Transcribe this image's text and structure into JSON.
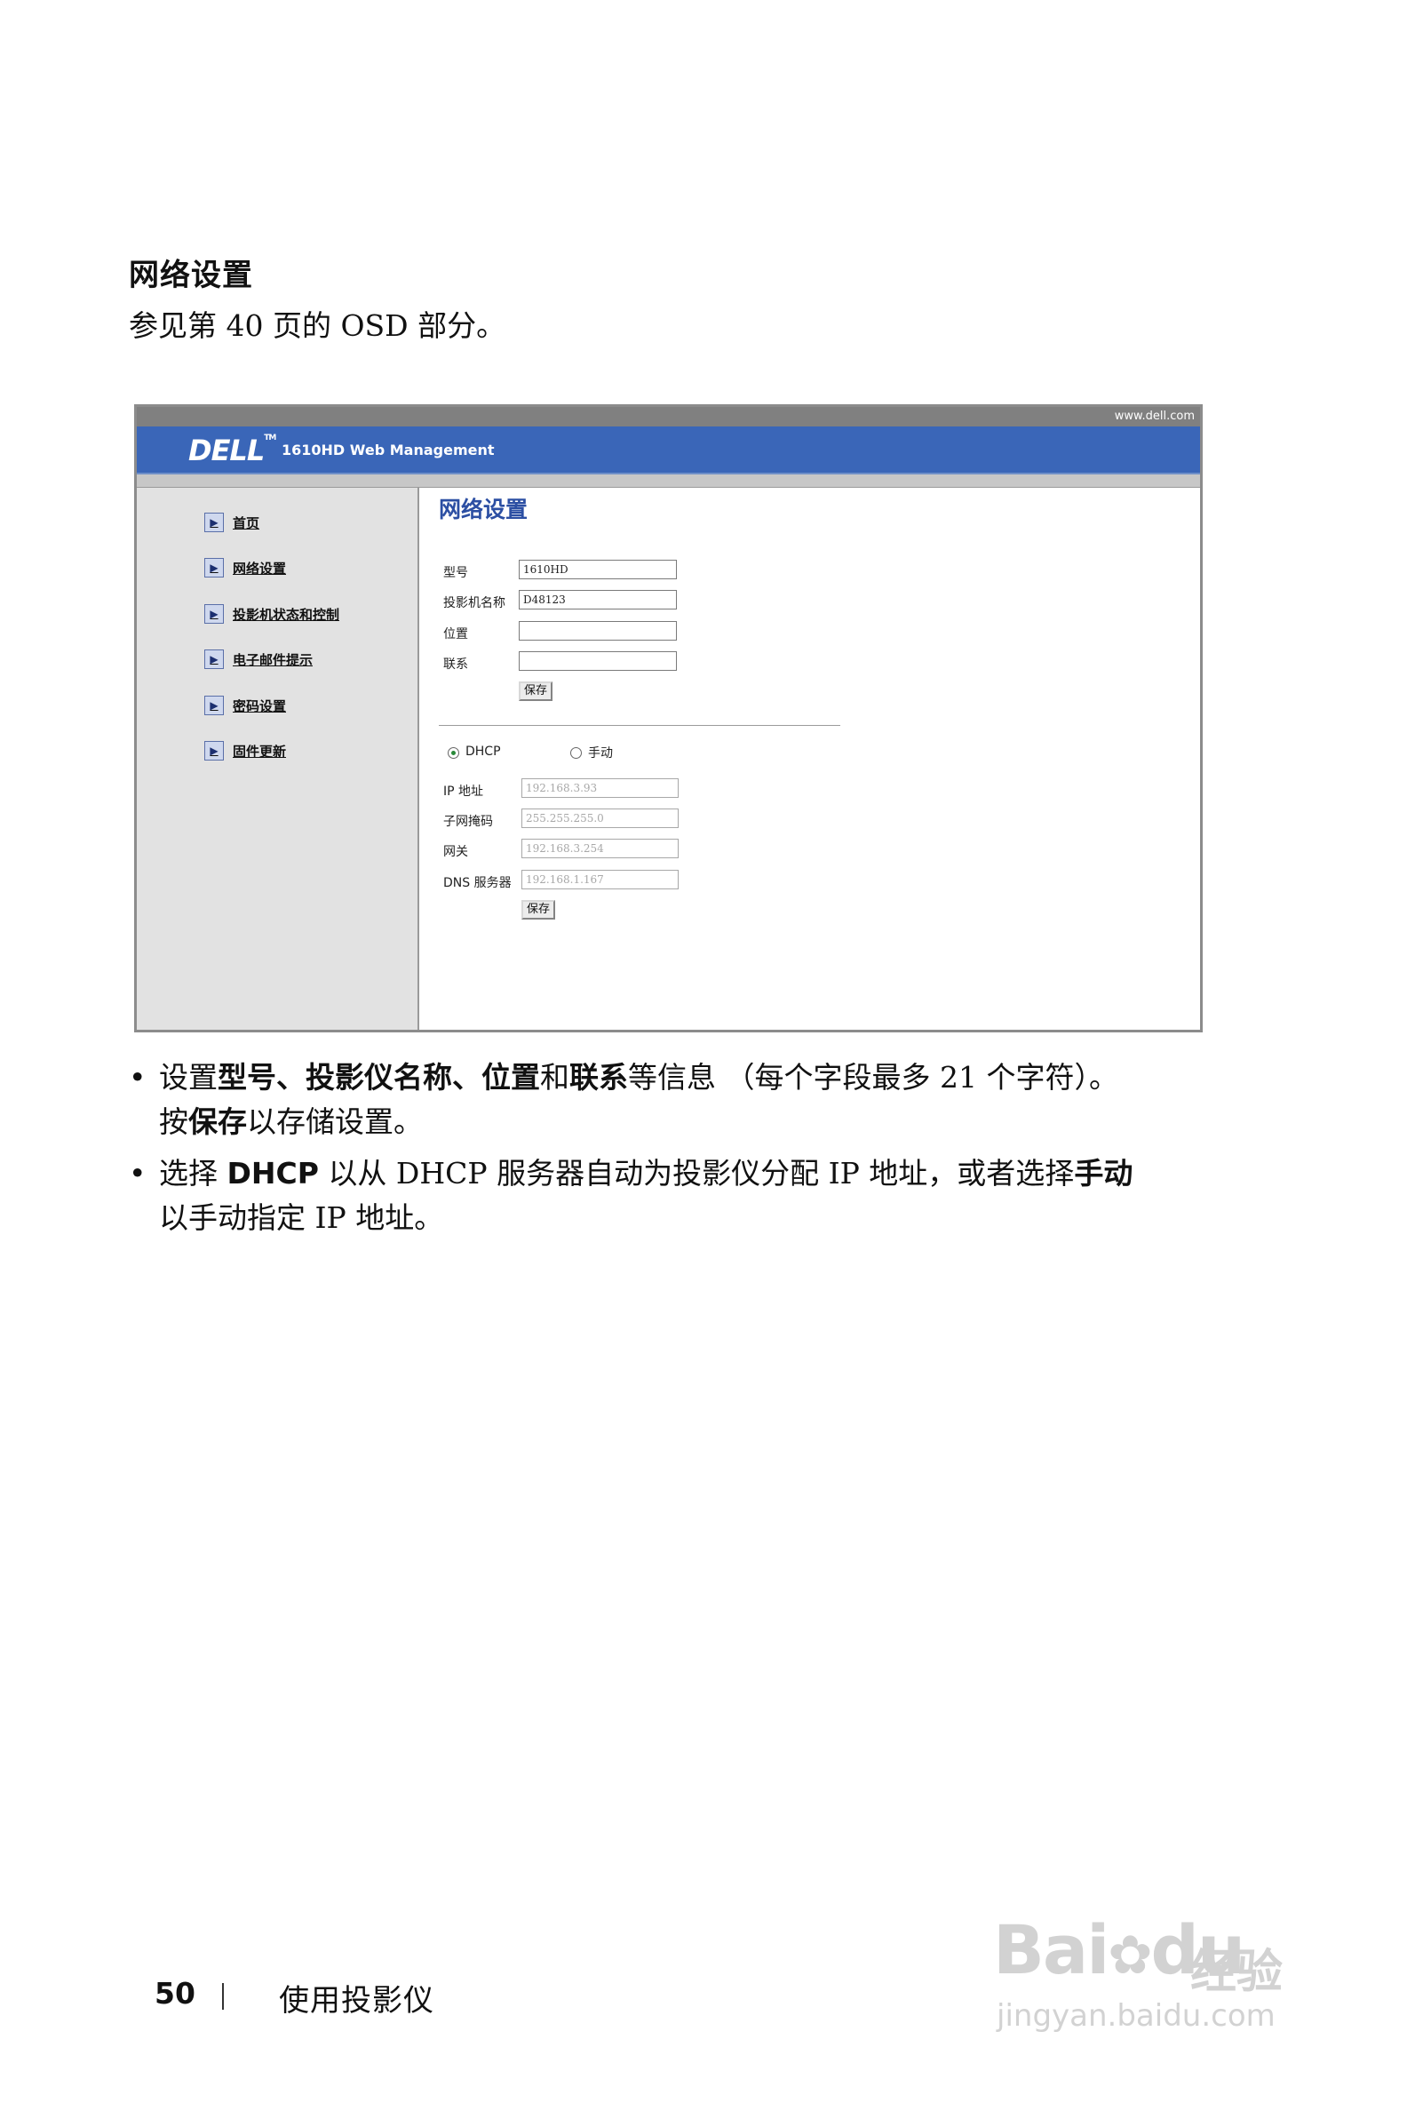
{
  "section": {
    "title": "网络设置",
    "subtitle": "参见第  40 页的 OSD 部分。"
  },
  "screenshot": {
    "url_text": "www.dell.com",
    "logo": "DELL",
    "app_title": "1610HD Web Management",
    "nav": [
      {
        "label": "首页",
        "icon": "play-arrow-icon"
      },
      {
        "label": "网络设置",
        "icon": "play-arrow-icon"
      },
      {
        "label": "投影机状态和控制",
        "icon": "play-arrow-icon"
      },
      {
        "label": "电子邮件提示",
        "icon": "play-arrow-icon"
      },
      {
        "label": "密码设置",
        "icon": "play-arrow-icon"
      },
      {
        "label": "固件更新",
        "icon": "play-arrow-icon"
      }
    ],
    "content_title": "网络设置",
    "fields": [
      {
        "label": "型号",
        "value": "1610HD"
      },
      {
        "label": "投影机名称",
        "value": "D48123"
      },
      {
        "label": "位置",
        "value": ""
      },
      {
        "label": "联系",
        "value": ""
      }
    ],
    "save_label": "保存",
    "radio": {
      "dhcp": "DHCP",
      "manual": "手动",
      "selected": "DHCP"
    },
    "network_fields": [
      {
        "label": "IP 地址",
        "value": "192.168.3.93"
      },
      {
        "label": "子网掩码",
        "value": "255.255.255.0"
      },
      {
        "label": "网关",
        "value": "192.168.3.254"
      },
      {
        "label": "DNS 服务器",
        "value": "192.168.1.167"
      }
    ],
    "save2_label": "保存"
  },
  "bullets": {
    "b1": {
      "p1": "设置",
      "k1": "型号、投影仪名称、位置",
      "p2": "和",
      "k2": "联系",
      "p3": "等信息 （每个字段最多 21 个字符）。",
      "p4": "按",
      "k3": "保存",
      "p5": "以存储设置。"
    },
    "b2": {
      "p1": "选择 ",
      "k1": "DHCP",
      "p2": " 以从 DHCP 服务器自动为投影仪分配 IP 地址，或者选择",
      "k2": "手动",
      "p3": "以手动指定 IP 地址。"
    },
    "dot": "•"
  },
  "footer": {
    "page_number": "50",
    "separator": "|",
    "chapter": "使用投影仪"
  },
  "watermark": {
    "brand": "Bai",
    "brand2": "du",
    "jingyan": "经验",
    "url": "jingyan.baidu.com"
  }
}
